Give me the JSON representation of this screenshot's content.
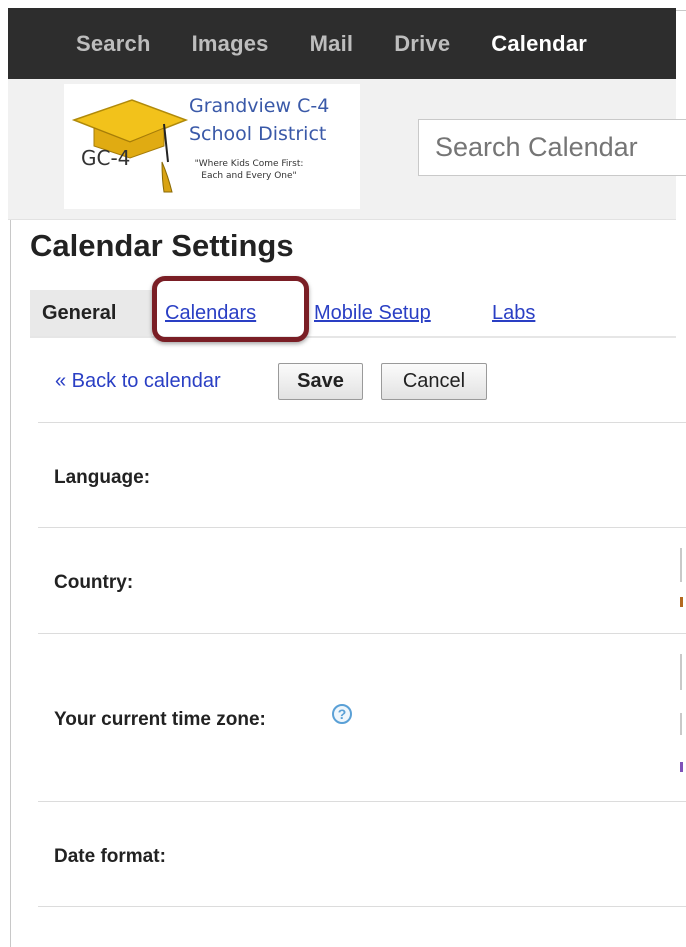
{
  "nav": {
    "items": [
      {
        "label": "Search",
        "active": false
      },
      {
        "label": "Images",
        "active": false
      },
      {
        "label": "Mail",
        "active": false
      },
      {
        "label": "Drive",
        "active": false
      },
      {
        "label": "Calendar",
        "active": true
      }
    ]
  },
  "logo": {
    "mark": "GC-4",
    "line1": "Grandview C-4",
    "line2": "School District",
    "tagline1": "\"Where Kids Come First:",
    "tagline2": "Each and Every One\""
  },
  "search": {
    "placeholder": "Search Calendar"
  },
  "page": {
    "title": "Calendar Settings"
  },
  "tabs": {
    "general": "General",
    "calendars": "Calendars",
    "mobile_setup": "Mobile Setup",
    "labs": "Labs"
  },
  "actions": {
    "back_label": "« Back to calendar",
    "save_label": "Save",
    "cancel_label": "Cancel"
  },
  "settings": {
    "language_label": "Language:",
    "country_label": "Country:",
    "timezone_label": "Your current time zone:",
    "date_format_label": "Date format:",
    "help_glyph": "?"
  },
  "colors": {
    "link": "#2a3fc4",
    "highlight": "#7a1e25",
    "nav_bg": "#2d2d2d"
  }
}
